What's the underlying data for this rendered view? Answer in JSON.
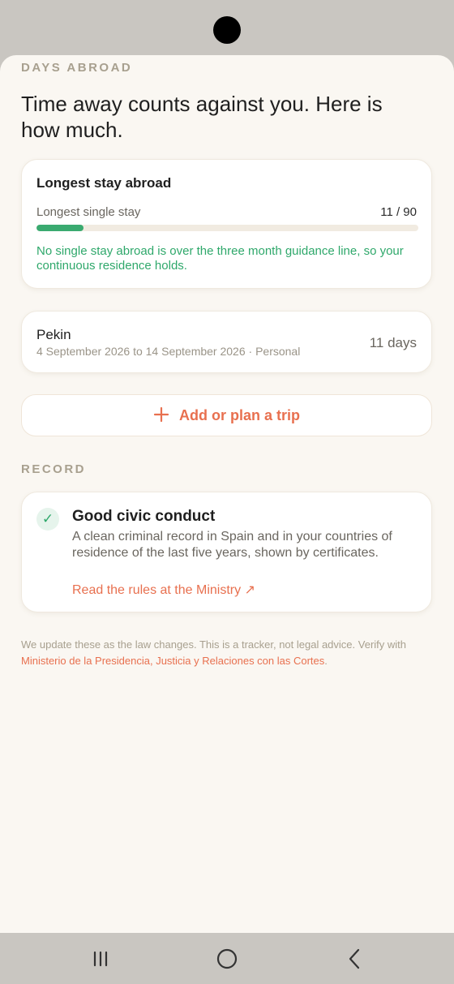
{
  "days_abroad": {
    "section_label": "DAYS ABROAD",
    "headline": "Time away counts against you. Here is how much.",
    "longest_stay": {
      "title": "Longest stay abroad",
      "progress_label": "Longest single stay",
      "progress_value": "11 / 90",
      "progress_fraction": 0.1222,
      "progress_color": "#3aaa70",
      "note": "No single stay abroad is over the three month guidance line, so your continuous residence holds."
    },
    "trips": [
      {
        "name": "Pekin",
        "dates": "4 September 2026 to 14 September 2026 · Personal",
        "duration": "11 days"
      }
    ],
    "add_trip": {
      "icon": "plus-icon",
      "label": "Add or plan a trip"
    }
  },
  "record": {
    "section_label": "RECORD",
    "item": {
      "icon": "check-icon",
      "title": "Good civic conduct",
      "description": "A clean criminal record in Spain and in your countries of residence of the last five years, shown by certificates.",
      "link_label": "Read the rules at the Ministry ↗"
    }
  },
  "disclaimer": {
    "text": "We update these as the law changes. This is a tracker, not legal advice. Verify with ",
    "link": "Ministerio de la Presidencia, Justicia y Relaciones con las Cortes",
    "suffix": "."
  },
  "navigation": {
    "recent_icon": "recent-apps-icon",
    "home_icon": "home-icon",
    "back_icon": "back-icon"
  },
  "colors": {
    "accent": "#e8704f",
    "success": "#2fa86b",
    "background": "#faf7f2"
  }
}
